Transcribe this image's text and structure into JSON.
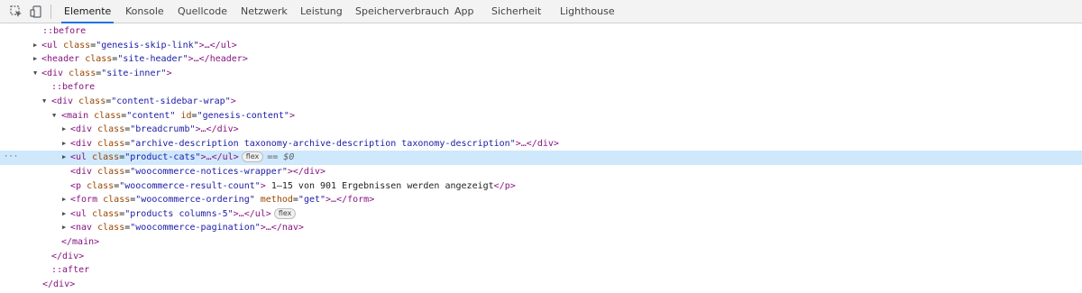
{
  "toolbar": {
    "tabs": [
      {
        "label": "Elemente"
      },
      {
        "label": "Konsole"
      },
      {
        "label": "Quellcode"
      },
      {
        "label": "Netzwerk"
      },
      {
        "label": "Leistung"
      },
      {
        "label": "Speicherverbrauch"
      },
      {
        "label": "App"
      },
      {
        "label": "Sicherheit"
      },
      {
        "label": "Lighthouse"
      }
    ],
    "active_tab": "Elemente",
    "accent_color": "#1a73e8"
  },
  "tree": {
    "selected_color": "#cfe8fc",
    "rows": [
      {
        "kind": "pseudo",
        "text": "::before"
      },
      {
        "kind": "collapsed",
        "open": "<ul",
        "attrs": [
          {
            "n": "class",
            "v": "\"genesis-skip-link\""
          }
        ],
        "close": ">…</ul>"
      },
      {
        "kind": "collapsed",
        "open": "<header",
        "attrs": [
          {
            "n": "class",
            "v": "\"site-header\""
          }
        ],
        "close": ">…</header>"
      },
      {
        "kind": "expanded",
        "open": "<div",
        "attrs": [
          {
            "n": "class",
            "v": "\"site-inner\""
          }
        ],
        "close": ">"
      },
      {
        "kind": "pseudo",
        "text": "::before"
      },
      {
        "kind": "expanded",
        "open": "<div",
        "attrs": [
          {
            "n": "class",
            "v": "\"content-sidebar-wrap\""
          }
        ],
        "close": ">"
      },
      {
        "kind": "expanded",
        "open": "<main",
        "attrs": [
          {
            "n": "class",
            "v": "\"content\""
          },
          {
            "n": "id",
            "v": "\"genesis-content\""
          }
        ],
        "close": ">"
      },
      {
        "kind": "collapsed",
        "open": "<div",
        "attrs": [
          {
            "n": "class",
            "v": "\"breadcrumb\""
          }
        ],
        "close": ">…</div>"
      },
      {
        "kind": "collapsed",
        "open": "<div",
        "attrs": [
          {
            "n": "class",
            "v": "\"archive-description taxonomy-archive-description taxonomy-description\""
          }
        ],
        "close": ">…</div>"
      },
      {
        "kind": "collapsed",
        "open": "<ul",
        "attrs": [
          {
            "n": "class",
            "v": "\"product-cats\""
          }
        ],
        "close": ">…</ul>",
        "badge": "flex",
        "selected": true,
        "eq": "==",
        "dollar": "$0"
      },
      {
        "kind": "leaf",
        "open": "<div",
        "attrs": [
          {
            "n": "class",
            "v": "\"woocommerce-notices-wrapper\""
          }
        ],
        "close": "></div>"
      },
      {
        "kind": "leaf",
        "open": "<p",
        "attrs": [
          {
            "n": "class",
            "v": "\"woocommerce-result-count\""
          }
        ],
        "close": ">",
        "text": " 1–15 von 901 Ergebnissen werden angezeigt",
        "end": "</p>"
      },
      {
        "kind": "collapsed",
        "open": "<form",
        "attrs": [
          {
            "n": "class",
            "v": "\"woocommerce-ordering\""
          },
          {
            "n": "method",
            "v": "\"get\""
          }
        ],
        "close": ">…</form>"
      },
      {
        "kind": "collapsed",
        "open": "<ul",
        "attrs": [
          {
            "n": "class",
            "v": "\"products columns-5\""
          }
        ],
        "close": ">…</ul>",
        "badge": "flex"
      },
      {
        "kind": "collapsed",
        "open": "<nav",
        "attrs": [
          {
            "n": "class",
            "v": "\"woocommerce-pagination\""
          }
        ],
        "close": ">…</nav>"
      },
      {
        "kind": "closing",
        "text": "</main>"
      },
      {
        "kind": "closing",
        "text": "</div>"
      },
      {
        "kind": "pseudo",
        "text": "::after"
      },
      {
        "kind": "closing",
        "text": "</div>"
      }
    ]
  }
}
